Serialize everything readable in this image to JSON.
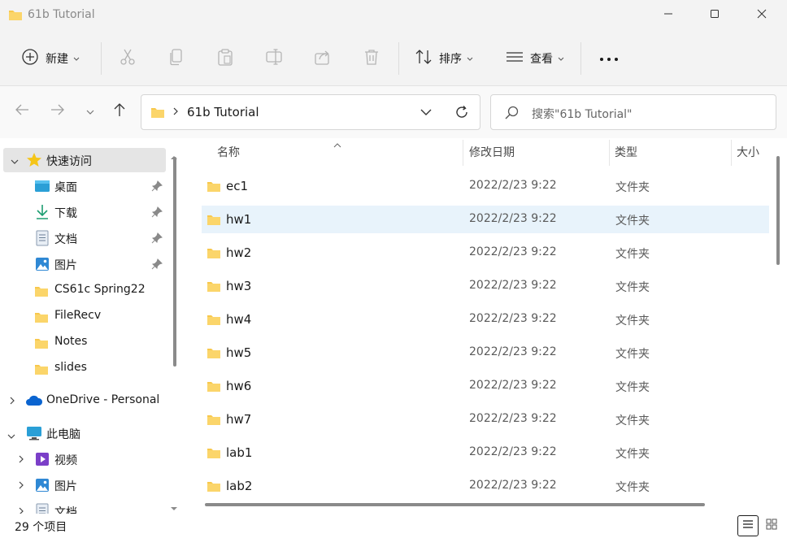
{
  "window": {
    "title": "61b Tutorial"
  },
  "toolbar": {
    "new_label": "新建",
    "sort_label": "排序",
    "view_label": "查看"
  },
  "address": {
    "path": "61b Tutorial"
  },
  "search": {
    "placeholder": "搜索\"61b Tutorial\""
  },
  "nav": {
    "quick_access": "快速访问",
    "items": [
      {
        "label": "桌面"
      },
      {
        "label": "下载"
      },
      {
        "label": "文档"
      },
      {
        "label": "图片"
      },
      {
        "label": "CS61c Spring22"
      },
      {
        "label": "FileRecv"
      },
      {
        "label": "Notes"
      },
      {
        "label": "slides"
      }
    ],
    "onedrive": "OneDrive - Personal",
    "this_pc": "此电脑",
    "pc_items": [
      {
        "label": "视频"
      },
      {
        "label": "图片"
      },
      {
        "label": "文档"
      }
    ]
  },
  "columns": {
    "name": "名称",
    "date": "修改日期",
    "type": "类型",
    "size": "大小"
  },
  "files": [
    {
      "name": "ec1",
      "date": "2022/2/23 9:22",
      "type": "文件夹"
    },
    {
      "name": "hw1",
      "date": "2022/2/23 9:22",
      "type": "文件夹"
    },
    {
      "name": "hw2",
      "date": "2022/2/23 9:22",
      "type": "文件夹"
    },
    {
      "name": "hw3",
      "date": "2022/2/23 9:22",
      "type": "文件夹"
    },
    {
      "name": "hw4",
      "date": "2022/2/23 9:22",
      "type": "文件夹"
    },
    {
      "name": "hw5",
      "date": "2022/2/23 9:22",
      "type": "文件夹"
    },
    {
      "name": "hw6",
      "date": "2022/2/23 9:22",
      "type": "文件夹"
    },
    {
      "name": "hw7",
      "date": "2022/2/23 9:22",
      "type": "文件夹"
    },
    {
      "name": "lab1",
      "date": "2022/2/23 9:22",
      "type": "文件夹"
    },
    {
      "name": "lab2",
      "date": "2022/2/23 9:22",
      "type": "文件夹"
    }
  ],
  "status": {
    "item_count": "29 个项目"
  },
  "colors": {
    "folder": "#f8c84c",
    "selection": "#e5e5e5",
    "hover_row": "#e8f3fb",
    "accent": "#0067c0"
  }
}
